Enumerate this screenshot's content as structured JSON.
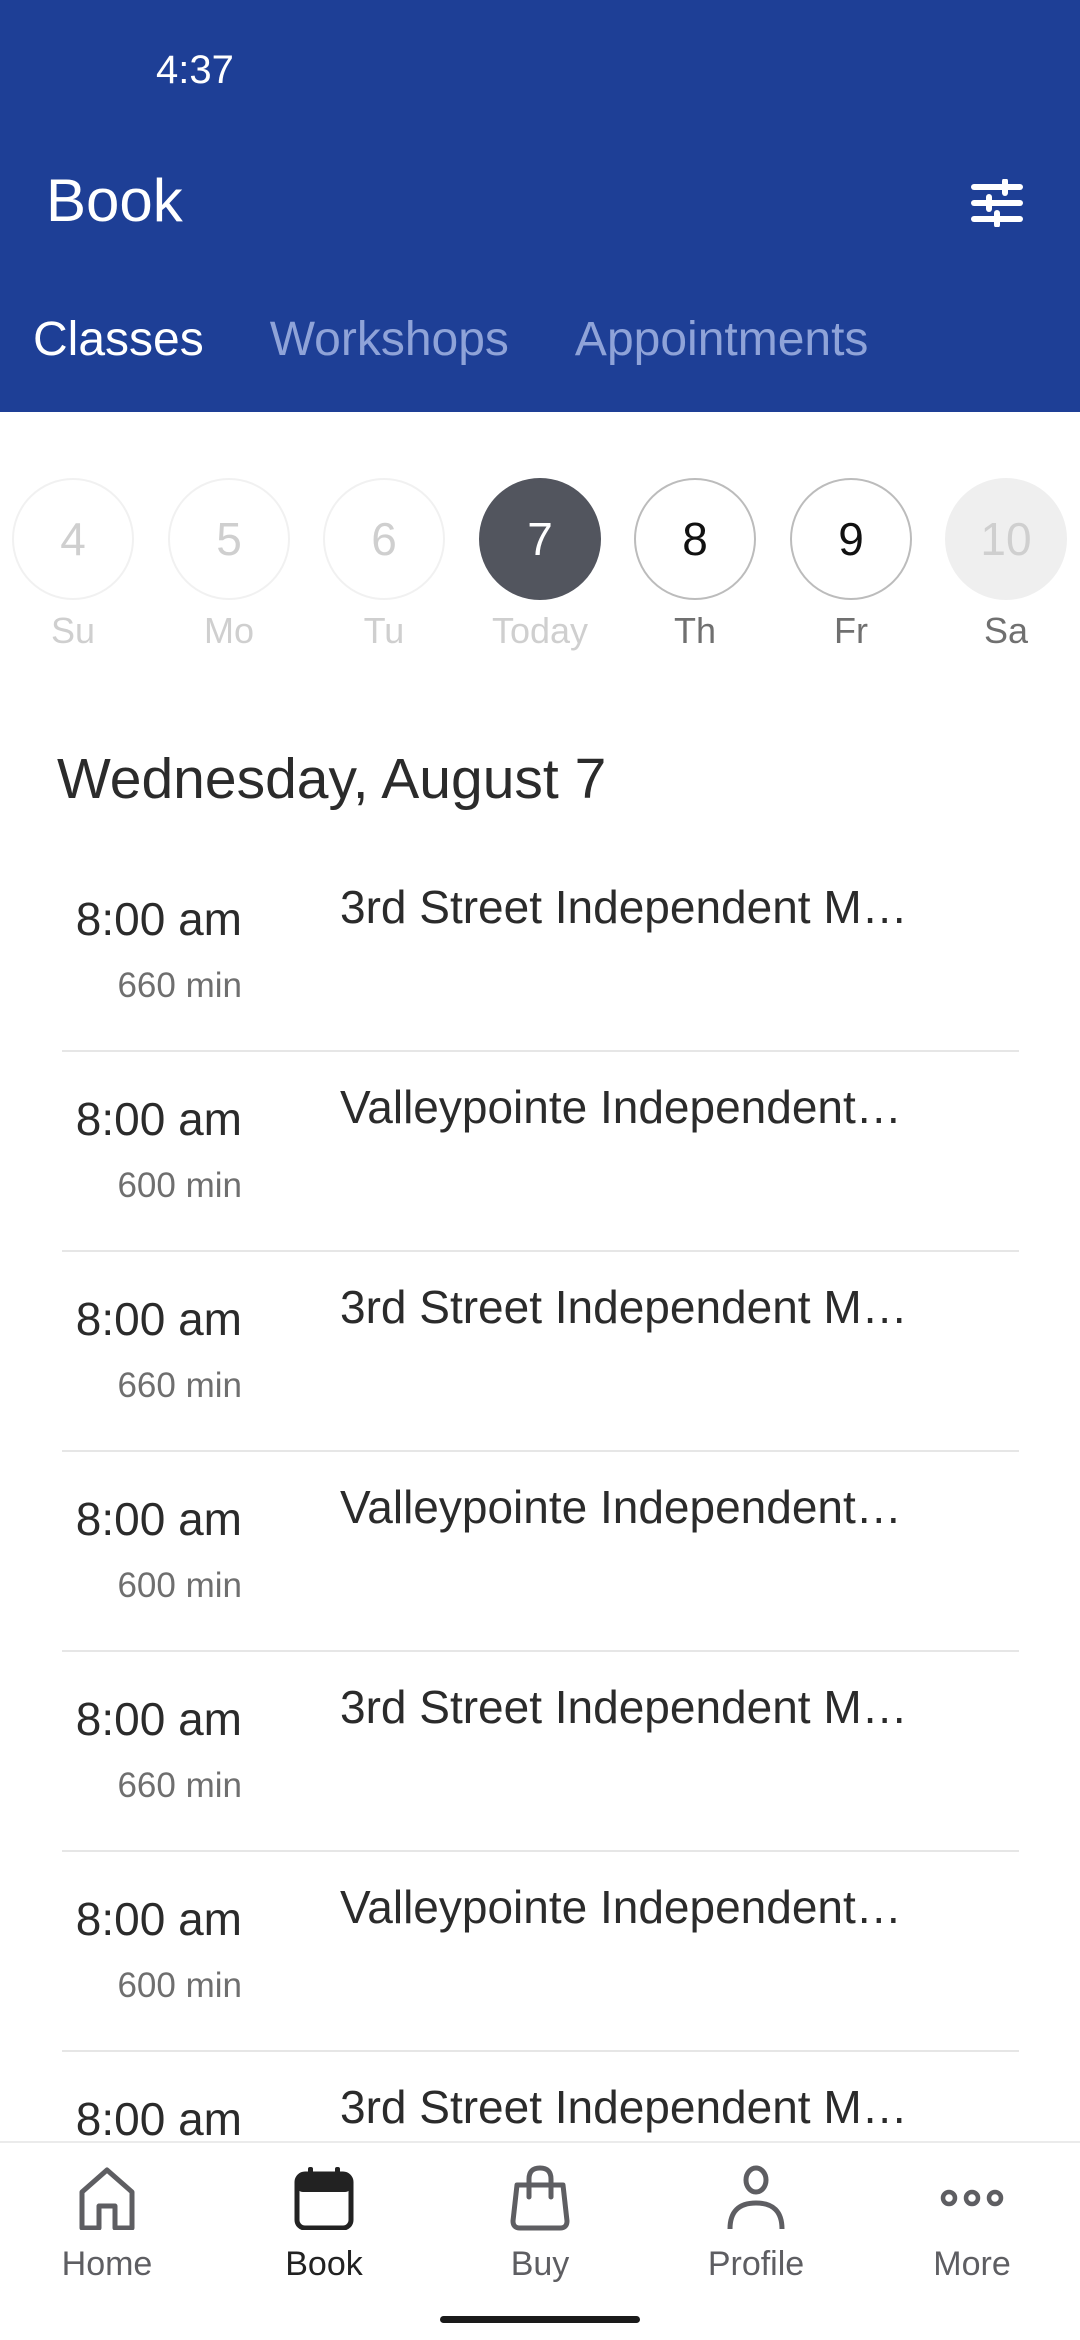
{
  "status_bar": {
    "time": "4:37"
  },
  "header": {
    "title": "Book",
    "filter_icon": "sliders-icon"
  },
  "tabs": [
    {
      "label": "Classes",
      "active": true
    },
    {
      "label": "Workshops",
      "active": false
    },
    {
      "label": "Appointments",
      "active": false
    }
  ],
  "date_strip": [
    {
      "day": "4",
      "label": "Su",
      "state": "past"
    },
    {
      "day": "5",
      "label": "Mo",
      "state": "past"
    },
    {
      "day": "6",
      "label": "Tu",
      "state": "past"
    },
    {
      "day": "7",
      "label": "Today",
      "state": "selected"
    },
    {
      "day": "8",
      "label": "Th",
      "state": "future"
    },
    {
      "day": "9",
      "label": "Fr",
      "state": "future"
    },
    {
      "day": "10",
      "label": "Sa",
      "state": "unavailable"
    }
  ],
  "day_heading": "Wednesday, August 7",
  "classes": [
    {
      "time": "8:00 am",
      "duration": "660 min",
      "name": "3rd Street Independent M…"
    },
    {
      "time": "8:00 am",
      "duration": "600 min",
      "name": "Valleypointe Independent…"
    },
    {
      "time": "8:00 am",
      "duration": "660 min",
      "name": "3rd Street Independent M…"
    },
    {
      "time": "8:00 am",
      "duration": "600 min",
      "name": "Valleypointe Independent…"
    },
    {
      "time": "8:00 am",
      "duration": "660 min",
      "name": "3rd Street Independent M…"
    },
    {
      "time": "8:00 am",
      "duration": "600 min",
      "name": "Valleypointe Independent…"
    },
    {
      "time": "8:00 am",
      "duration": "",
      "name": "3rd Street Independent M…"
    }
  ],
  "bottom_nav": [
    {
      "label": "Home",
      "icon": "home-icon",
      "active": false
    },
    {
      "label": "Book",
      "icon": "calendar-icon",
      "active": true
    },
    {
      "label": "Buy",
      "icon": "shopping-bag-icon",
      "active": false
    },
    {
      "label": "Profile",
      "icon": "person-icon",
      "active": false
    },
    {
      "label": "More",
      "icon": "more-dots-icon",
      "active": false
    }
  ],
  "colors": {
    "header_bg": "#1e3f96",
    "tab_inactive": "#8fa3d8",
    "selected_date": "#52555e"
  }
}
